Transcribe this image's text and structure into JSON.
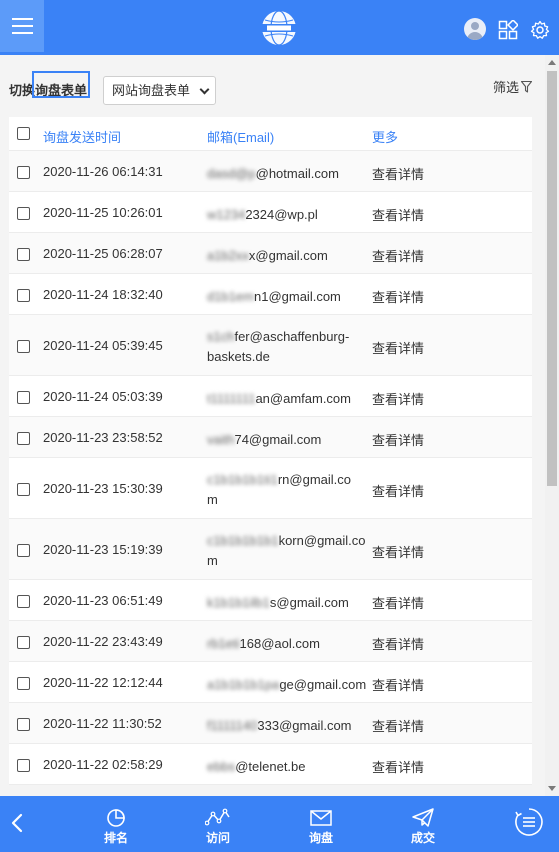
{
  "toolbar": {
    "switch_label": "切换询盘表单",
    "form_selected": "网站询盘表单",
    "filter_label": "筛选"
  },
  "table": {
    "headers": {
      "time": "询盘发送时间",
      "email": "邮箱(Email)",
      "more": "更多"
    },
    "rows": [
      {
        "time": "2020-11-26 06:14:31",
        "email_hidden": "dasd@p",
        "email_visible": "@hotmail.com",
        "email_line2": "",
        "more": "查看详情"
      },
      {
        "time": "2020-11-25 10:26:01",
        "email_hidden": "w1234",
        "email_visible": "2324@wp.pl",
        "email_line2": "",
        "more": "查看详情"
      },
      {
        "time": "2020-11-25 06:28:07",
        "email_hidden": "a1b2xx",
        "email_visible": "x@gmail.com",
        "email_line2": "",
        "more": "查看详情"
      },
      {
        "time": "2020-11-24 18:32:40",
        "email_hidden": "d1b1em",
        "email_visible": "n1@gmail.com",
        "email_line2": "",
        "more": "查看详情"
      },
      {
        "time": "2020-11-24 05:39:45",
        "email_hidden": "s1ch",
        "email_visible": "fer@aschaffenburg-",
        "email_line2": "baskets.de",
        "more": "查看详情"
      },
      {
        "time": "2020-11-24 05:03:39",
        "email_hidden": "t1111111",
        "email_visible": "an@amfam.com",
        "email_line2": "",
        "more": "查看详情"
      },
      {
        "time": "2020-11-23 23:58:52",
        "email_hidden": "vaith",
        "email_visible": "74@gmail.com",
        "email_line2": "",
        "more": "查看详情"
      },
      {
        "time": "2020-11-23 15:30:39",
        "email_hidden": "c1b1b1b1ti1",
        "email_visible": "rn@gmail.co",
        "email_line2": "m",
        "more": "查看详情"
      },
      {
        "time": "2020-11-23 15:19:39",
        "email_hidden": "c1b1b1b1b1",
        "email_visible": "korn@gmail.co",
        "email_line2": "m",
        "more": "查看详情"
      },
      {
        "time": "2020-11-23 06:51:49",
        "email_hidden": "k1b1b1ilb1",
        "email_visible": "s@gmail.com",
        "email_line2": "",
        "more": "查看详情"
      },
      {
        "time": "2020-11-22 23:43:49",
        "email_hidden": "rb1eti",
        "email_visible": "168@aol.com",
        "email_line2": "",
        "more": "查看详情"
      },
      {
        "time": "2020-11-22 12:12:44",
        "email_hidden": "a1b1b1b1pa",
        "email_visible": "ge@gmail.com",
        "email_line2": "",
        "more": "查看详情"
      },
      {
        "time": "2020-11-22 11:30:52",
        "email_hidden": "f1111140",
        "email_visible": "333@gmail.com",
        "email_line2": "",
        "more": "查看详情"
      },
      {
        "time": "2020-11-22 02:58:29",
        "email_hidden": "ebbs",
        "email_visible": "@telenet.be",
        "email_line2": "",
        "more": "查看详情"
      }
    ]
  },
  "nav": {
    "items": [
      {
        "label": "排名",
        "icon": "pie-chart-icon"
      },
      {
        "label": "访问",
        "icon": "line-trend-icon"
      },
      {
        "label": "询盘",
        "icon": "envelope-icon"
      },
      {
        "label": "成交",
        "icon": "paper-plane-icon"
      }
    ]
  },
  "colors": {
    "primary": "#3a82f6",
    "header_light": "#5c9bf9",
    "link": "#3a82f6"
  }
}
